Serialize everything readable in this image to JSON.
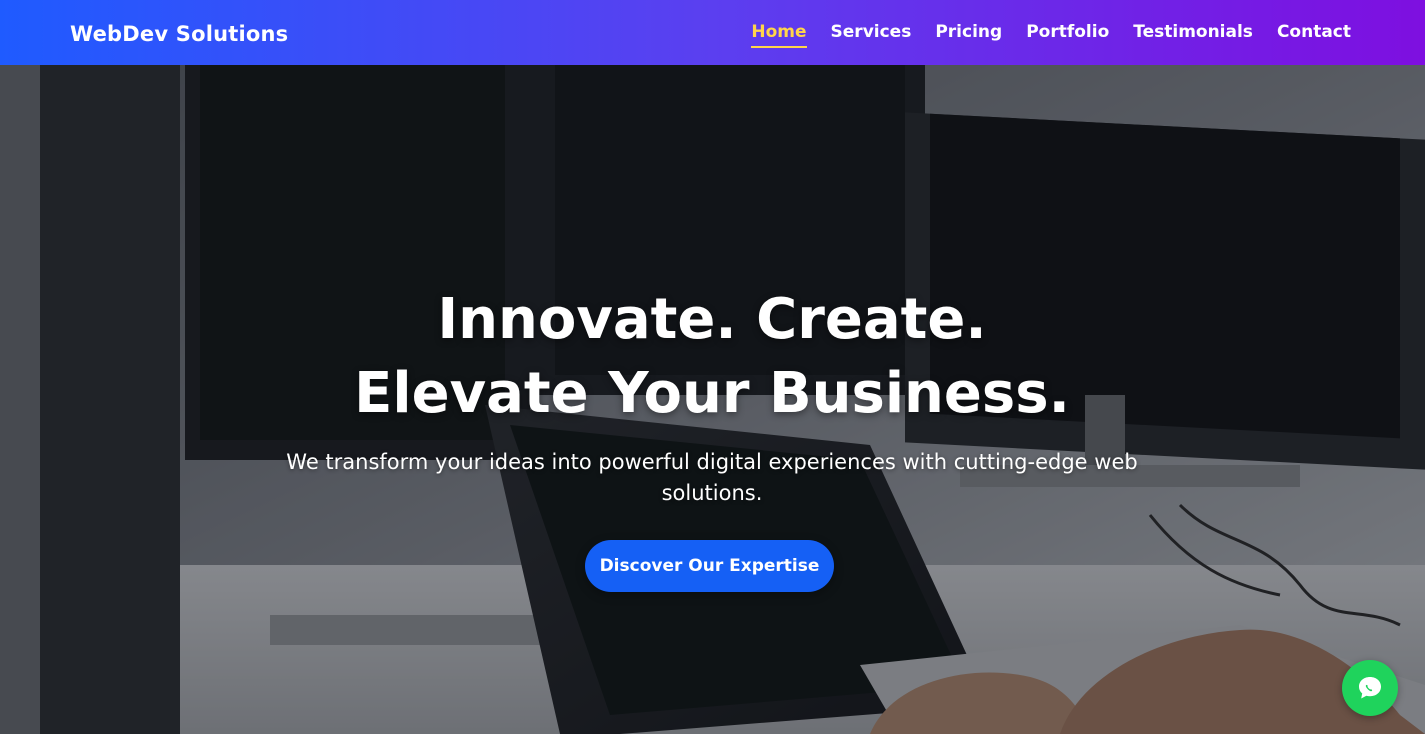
{
  "brand": {
    "name": "WebDev Solutions"
  },
  "nav": {
    "items": [
      {
        "label": "Home",
        "active": true
      },
      {
        "label": "Services",
        "active": false
      },
      {
        "label": "Pricing",
        "active": false
      },
      {
        "label": "Portfolio",
        "active": false
      },
      {
        "label": "Testimonials",
        "active": false
      },
      {
        "label": "Contact",
        "active": false
      }
    ]
  },
  "hero": {
    "title": "Innovate. Create. Elevate Your Business.",
    "subtitle": "We transform your ideas into powerful digital experiences with cutting-edge web solutions.",
    "cta_label": "Discover Our Expertise",
    "background_image": "developer-workstation-photo"
  },
  "chat_fab": {
    "icon": "chat-bubble-icon"
  },
  "colors": {
    "nav_gradient_start": "#1f5bff",
    "nav_gradient_end": "#7e0fe0",
    "active_link": "#ffd54a",
    "cta": "#1560f5",
    "chat_fab": "#1fd35c"
  }
}
